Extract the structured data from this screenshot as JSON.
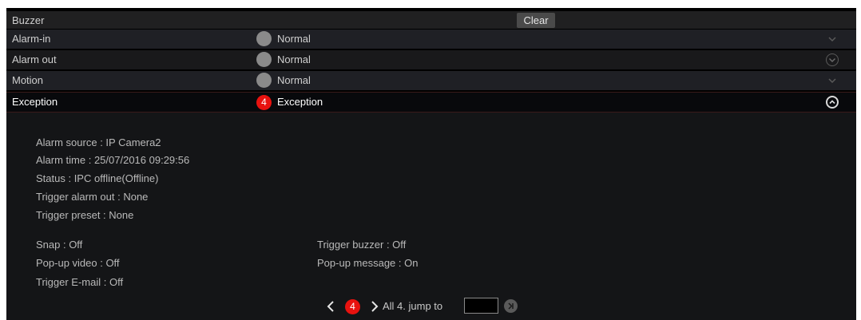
{
  "header": {
    "title": "Buzzer",
    "clear_label": "Clear"
  },
  "rows": [
    {
      "label": "Alarm-in",
      "status": "Normal"
    },
    {
      "label": "Alarm out",
      "status": "Normal"
    },
    {
      "label": "Motion",
      "status": "Normal"
    },
    {
      "label": "Exception",
      "status": "Exception",
      "count": "4"
    }
  ],
  "detail": {
    "alarm_source": "Alarm source : IP Camera2",
    "alarm_time": "Alarm time : 25/07/2016 09:29:56",
    "status": "Status : IPC offline(Offline)",
    "trigger_alarm_out": "Trigger alarm out : None",
    "trigger_preset": "Trigger preset : None",
    "snap": "Snap : Off",
    "popup_video": "Pop-up video : Off",
    "trigger_email": "Trigger E-mail : Off",
    "trigger_buzzer": "Trigger buzzer : Off",
    "popup_message": "Pop-up message : On"
  },
  "pager": {
    "current": "4",
    "summary": "All 4. jump to",
    "jump_value": ""
  },
  "colors": {
    "accent_red": "#e8120f",
    "status_grey": "#8a8a8a"
  },
  "icons": {
    "collapse": "chevron-down-icon",
    "expand": "chevron-up-icon",
    "prev": "chevron-left-icon",
    "next": "chevron-right-icon",
    "go": "skip-to-end-icon"
  }
}
